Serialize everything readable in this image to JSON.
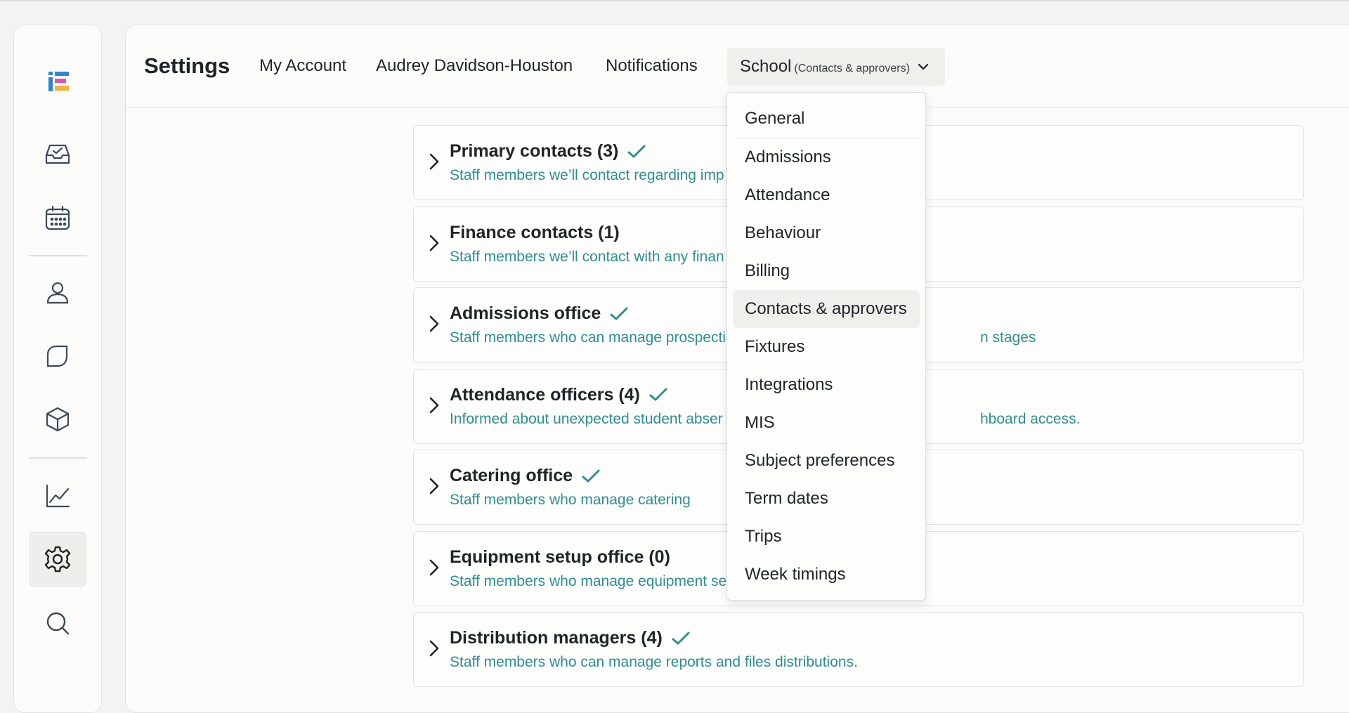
{
  "header": {
    "title": "Settings",
    "nav": [
      {
        "label": "My Account"
      },
      {
        "label": "Audrey Davidson-Houston"
      },
      {
        "label": "Notifications"
      }
    ],
    "dropdown": {
      "label": "School",
      "sublabel": "(Contacts & approvers)"
    }
  },
  "sidebar": {
    "logo": "logo-icon",
    "items": [
      {
        "icon": "inbox-check-icon"
      },
      {
        "icon": "calendar-icon"
      },
      {
        "icon": "person-icon"
      },
      {
        "icon": "leaf-icon"
      },
      {
        "icon": "cube-icon"
      },
      {
        "icon": "chart-icon"
      },
      {
        "icon": "gear-icon",
        "active": true
      },
      {
        "icon": "search-icon"
      }
    ]
  },
  "cards": [
    {
      "title": "Primary contacts (3)",
      "checked": true,
      "desc": "Staff members we’ll contact regarding imp"
    },
    {
      "title": "Finance contacts (1)",
      "checked": false,
      "desc": "Staff members we’ll contact with any finan"
    },
    {
      "title": "Admissions office",
      "checked": true,
      "desc": "Staff members who can manage prospecti",
      "desc_tail": "n stages"
    },
    {
      "title": "Attendance officers (4)",
      "checked": true,
      "desc": "Informed about unexpected student abser",
      "desc_tail": "hboard access."
    },
    {
      "title": "Catering office",
      "checked": true,
      "desc": "Staff members who manage catering"
    },
    {
      "title": "Equipment setup office (0)",
      "checked": false,
      "desc": "Staff members who manage equipment se"
    },
    {
      "title": "Distribution managers (4)",
      "checked": true,
      "desc": "Staff members who can manage reports and files distributions."
    }
  ],
  "menu": {
    "items": [
      {
        "label": "General"
      },
      {
        "label": "Admissions"
      },
      {
        "label": "Attendance"
      },
      {
        "label": "Behaviour"
      },
      {
        "label": "Billing"
      },
      {
        "label": "Contacts & approvers",
        "active": true
      },
      {
        "label": "Fixtures"
      },
      {
        "label": "Integrations"
      },
      {
        "label": "MIS"
      },
      {
        "label": "Subject preferences"
      },
      {
        "label": "Term dates"
      },
      {
        "label": "Trips"
      },
      {
        "label": "Week timings"
      }
    ]
  },
  "colors": {
    "accent": "#2b8f92",
    "active_bg": "#efefec"
  }
}
